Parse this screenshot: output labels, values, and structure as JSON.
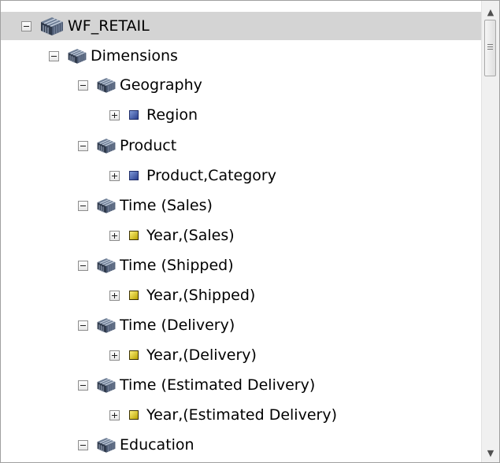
{
  "tree": {
    "rows": [
      {
        "label": "WF_RETAIL",
        "icon": "cube-large-icon",
        "expander": "collapse",
        "selected": true
      },
      {
        "label": "Dimensions",
        "icon": "cube-icon",
        "expander": "collapse"
      },
      {
        "label": "Geography",
        "icon": "cube-icon",
        "expander": "collapse"
      },
      {
        "label": "Region",
        "icon": "level-icon",
        "expander": "expand",
        "color": "#3b55b0"
      },
      {
        "label": "Product",
        "icon": "cube-icon",
        "expander": "collapse"
      },
      {
        "label": "Product,Category",
        "icon": "level-icon",
        "expander": "expand",
        "color": "#3b55b0"
      },
      {
        "label": "Time (Sales)",
        "icon": "cube-icon",
        "expander": "collapse"
      },
      {
        "label": "Year,(Sales)",
        "icon": "level-icon",
        "expander": "expand",
        "color": "#e8d400"
      },
      {
        "label": "Time (Shipped)",
        "icon": "cube-icon",
        "expander": "collapse"
      },
      {
        "label": "Year,(Shipped)",
        "icon": "level-icon",
        "expander": "expand",
        "color": "#e8d400"
      },
      {
        "label": "Time (Delivery)",
        "icon": "cube-icon",
        "expander": "collapse"
      },
      {
        "label": "Year,(Delivery)",
        "icon": "level-icon",
        "expander": "expand",
        "color": "#e8d400"
      },
      {
        "label": "Time (Estimated Delivery)",
        "icon": "cube-icon",
        "expander": "collapse"
      },
      {
        "label": "Year,(Estimated Delivery)",
        "icon": "level-icon",
        "expander": "expand",
        "color": "#e8d400"
      },
      {
        "label": "Education",
        "icon": "cube-icon",
        "expander": "collapse"
      }
    ]
  },
  "scrollbar": {
    "up_icon": "arrow-up-icon",
    "down_icon": "arrow-down-icon"
  }
}
